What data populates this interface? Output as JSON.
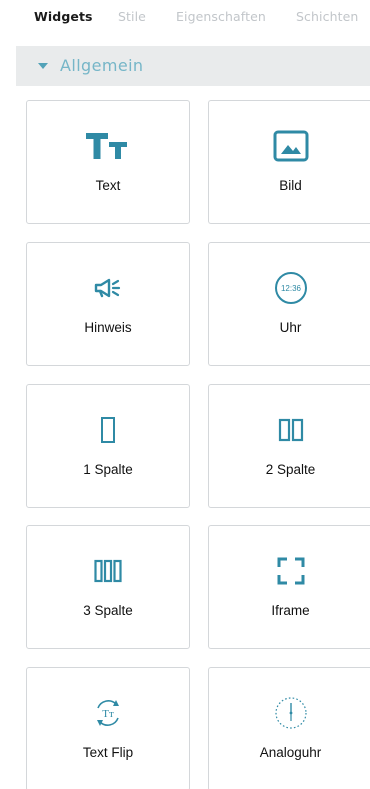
{
  "tabs": [
    {
      "label": "Widgets",
      "active": true
    },
    {
      "label": "Stile",
      "active": false
    },
    {
      "label": "Eigenschaften",
      "active": false
    },
    {
      "label": "Schichten",
      "active": false
    }
  ],
  "section": {
    "title": "Allgemein",
    "expanded": true
  },
  "widgets": [
    {
      "label": "Text",
      "icon": "text-size-icon"
    },
    {
      "label": "Bild",
      "icon": "image-icon"
    },
    {
      "label": "Hinweis",
      "icon": "megaphone-icon"
    },
    {
      "label": "Uhr",
      "icon": "digital-clock-icon",
      "icon_text": "12:36"
    },
    {
      "label": "1 Spalte",
      "icon": "one-column-icon"
    },
    {
      "label": "2 Spalte",
      "icon": "two-column-icon"
    },
    {
      "label": "3 Spalte",
      "icon": "three-column-icon"
    },
    {
      "label": "Iframe",
      "icon": "iframe-corners-icon"
    },
    {
      "label": "Text Flip",
      "icon": "text-flip-icon",
      "icon_text": "Tт"
    },
    {
      "label": "Analoguhr",
      "icon": "analog-clock-icon"
    }
  ],
  "colors": {
    "accent": "#2f8aa5",
    "accent_light": "#76b6c8",
    "header_bg": "#e9ebec",
    "tab_inactive": "#c2c6ca",
    "card_border": "#d4d7da"
  }
}
